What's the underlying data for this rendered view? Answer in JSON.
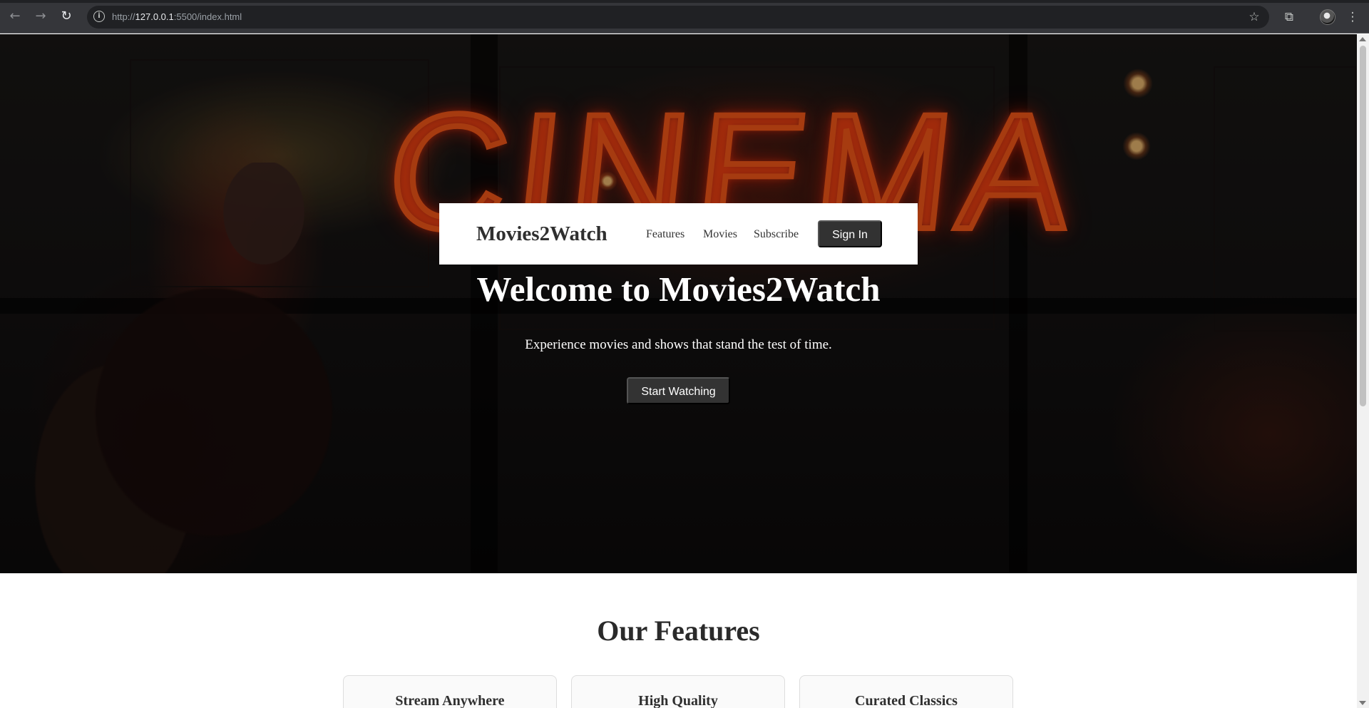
{
  "browser": {
    "url_scheme": "http://",
    "url_host": "127.0.0.1",
    "url_path": ":5500/index.html",
    "icons": {
      "back": "back-arrow-icon",
      "forward": "forward-arrow-icon",
      "reload": "reload-icon",
      "site_info": "info-icon",
      "bookmark": "star-icon",
      "extensions": "puzzle-icon",
      "profile": "avatar",
      "menu": "more-vertical-icon"
    }
  },
  "hero": {
    "brand": "Movies2Watch",
    "nav_links": [
      "Features",
      "Movies",
      "Subscribe"
    ],
    "signin_label": "Sign In",
    "title": "Welcome to Movies2Watch",
    "subtitle": "Experience movies and shows that stand the test of time.",
    "cta_label": "Start Watching"
  },
  "features": {
    "heading": "Our Features",
    "cards": [
      "Stream Anywhere",
      "High Quality",
      "Curated Classics"
    ]
  },
  "colors": {
    "button_dark": "#323232",
    "neon": "#ff5b19",
    "browser_chrome": "#35363a"
  }
}
